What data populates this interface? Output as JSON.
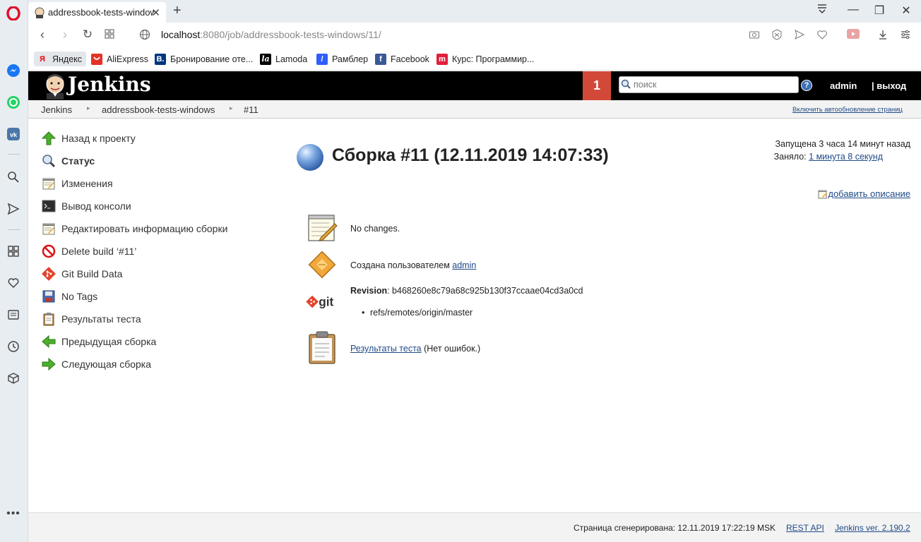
{
  "browser": {
    "tab_title": "addressbook-tests-windows",
    "url_host": "localhost",
    "url_rest": ":8080/job/addressbook-tests-windows/11/",
    "bookmarks": [
      {
        "label": "Яндекс",
        "icon": "yandex-icon",
        "letter": "Я",
        "color": "#ffffff"
      },
      {
        "label": "AliExpress",
        "icon": "aliexpress-icon",
        "letter": "",
        "color": "#e43225"
      },
      {
        "label": "Бронирование оте...",
        "icon": "booking-icon",
        "letter": "B.",
        "color": "#003580"
      },
      {
        "label": "Lamoda",
        "icon": "lamoda-icon",
        "letter": "la",
        "color": "#000000"
      },
      {
        "label": "Рамблер",
        "icon": "rambler-icon",
        "letter": "/",
        "color": "#315efb"
      },
      {
        "label": "Facebook",
        "icon": "facebook-icon",
        "letter": "f",
        "color": "#3b5998"
      },
      {
        "label": "Курс: Программир...",
        "icon": "course-icon",
        "letter": "m",
        "color": "#e31e3c"
      }
    ]
  },
  "jenkins": {
    "logo_text": "Jenkins",
    "badge_count": "1",
    "search_placeholder": "поиск",
    "help": "?",
    "user": "admin",
    "logout": "| выход"
  },
  "breadcrumb": {
    "items": [
      "Jenkins",
      "addressbook-tests-windows",
      "#11"
    ],
    "autorefresh": "Включить автообновление страниц"
  },
  "tasks": [
    {
      "label": "Назад к проекту",
      "icon": "up-arrow-icon"
    },
    {
      "label": "Статус",
      "icon": "search-icon"
    },
    {
      "label": "Изменения",
      "icon": "notepad-icon"
    },
    {
      "label": "Вывод консоли",
      "icon": "terminal-icon"
    },
    {
      "label": "Редактировать информацию сборки",
      "icon": "notepad-icon"
    },
    {
      "label": "Delete build ‘#11’",
      "icon": "no-entry-icon"
    },
    {
      "label": "Git Build Data",
      "icon": "git-icon"
    },
    {
      "label": "No Tags",
      "icon": "save-icon"
    },
    {
      "label": "Результаты теста",
      "icon": "clipboard-icon"
    },
    {
      "label": "Предыдущая сборка",
      "icon": "left-arrow-icon"
    },
    {
      "label": "Следующая сборка",
      "icon": "right-arrow-icon"
    }
  ],
  "build": {
    "title": "Сборка #11 (12.11.2019 14:07:33)",
    "status_color": "#2f5ea8",
    "started": "Запущена 3 часа 14 минут назад",
    "took_label": "Заняло: ",
    "took_value": "1 минута 8 секунд",
    "add_description": "добавить описание",
    "no_changes": "No changes.",
    "created_by_label": "Создана пользователем ",
    "created_by_user": "admin",
    "revision_label": "Revision",
    "revision_value": ": b468260e8c79a68c925b130f37ccaae04cd3a0cd",
    "branch": "refs/remotes/origin/master",
    "test_results_link": "Результаты теста",
    "test_results_note": " (Нет ошибок.)"
  },
  "footer": {
    "generated": "Страница сгенерирована: 12.11.2019 17:22:19 MSK",
    "rest_api": "REST API",
    "version": "Jenkins ver. 2.190.2"
  }
}
